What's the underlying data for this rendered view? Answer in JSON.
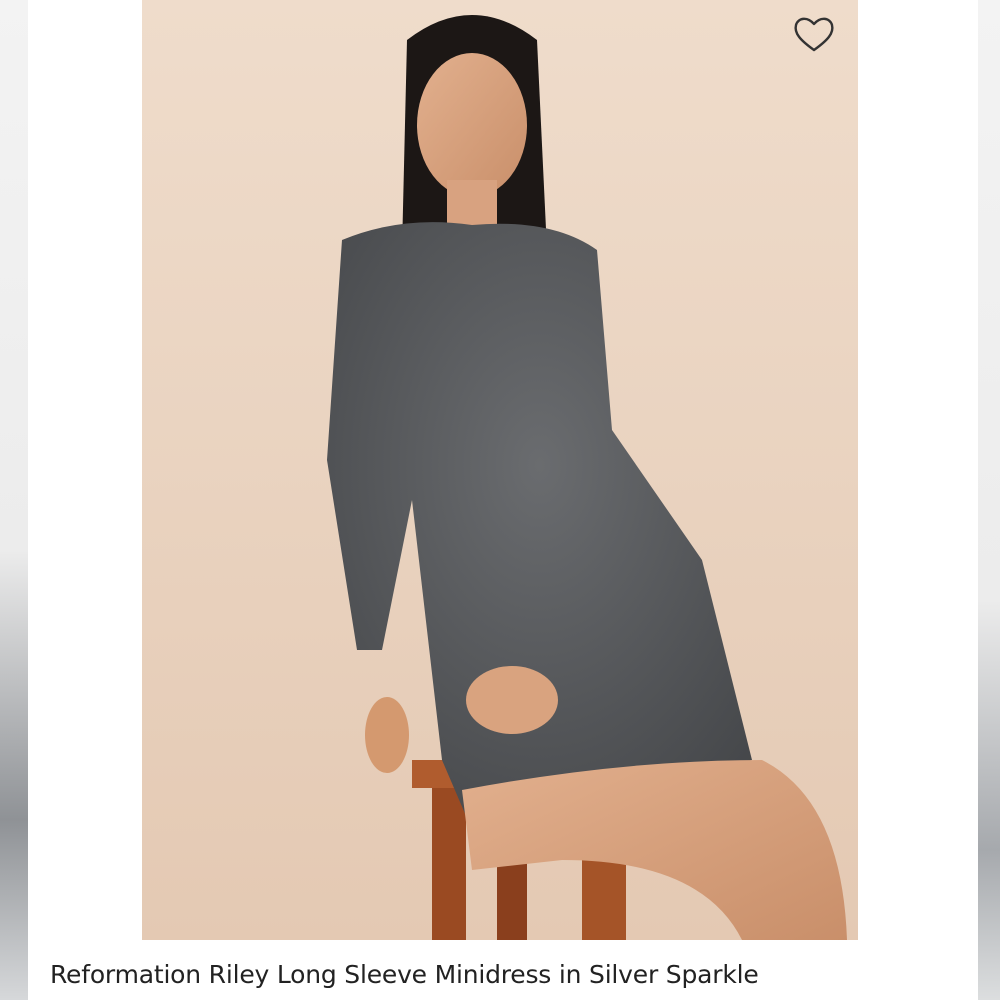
{
  "listing": {
    "title": "Reformation Riley Long Sleeve Minidress in Silver Sparkle"
  },
  "icons": {
    "favorite": "heart-outline-icon"
  },
  "colors": {
    "backdrop": "#ead4c1",
    "dress": "#55575a",
    "text": "#222222"
  }
}
